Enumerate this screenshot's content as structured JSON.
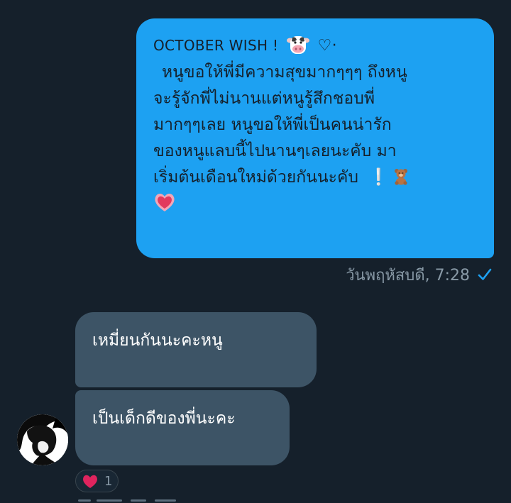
{
  "sent_message": {
    "header_text": "OCTOBER WISH !",
    "header_heart": "♡·",
    "lines": [
      "หนูขอให้พี่มีความสุขมากๆๆๆ ถึงหนู",
      "จะรู้จักพี่ไม่นานแต่หนูรู้สึกชอบพี่",
      "มากๆๆเลย หนูขอให้พี่เป็นคนน่ารัก",
      "ของหนูแลบนี้ไปนานๆเลยนะคับ มา",
      "เริ่มต้นเดือนใหม่ด้วยกันนะคับ"
    ],
    "exclamation": "❕",
    "emojis": [
      "cow-face",
      "teddy-bear",
      "pink-heart"
    ],
    "timestamp": "วันพฤหัสบดี, 7:28",
    "status": "delivered-check"
  },
  "received_messages": [
    {
      "text": "เหมี่ยนกันนะคะหนู"
    },
    {
      "text": "เป็นเด็กดีของพี่นะคะ"
    }
  ],
  "reaction": {
    "emoji": "heart",
    "count": "1"
  },
  "colors": {
    "background": "#15202b",
    "sent_bubble": "#1da1f2",
    "received_bubble": "#3d5466",
    "meta_text": "#8899a6",
    "check": "#1da1f2",
    "heart": "#e0245e"
  }
}
